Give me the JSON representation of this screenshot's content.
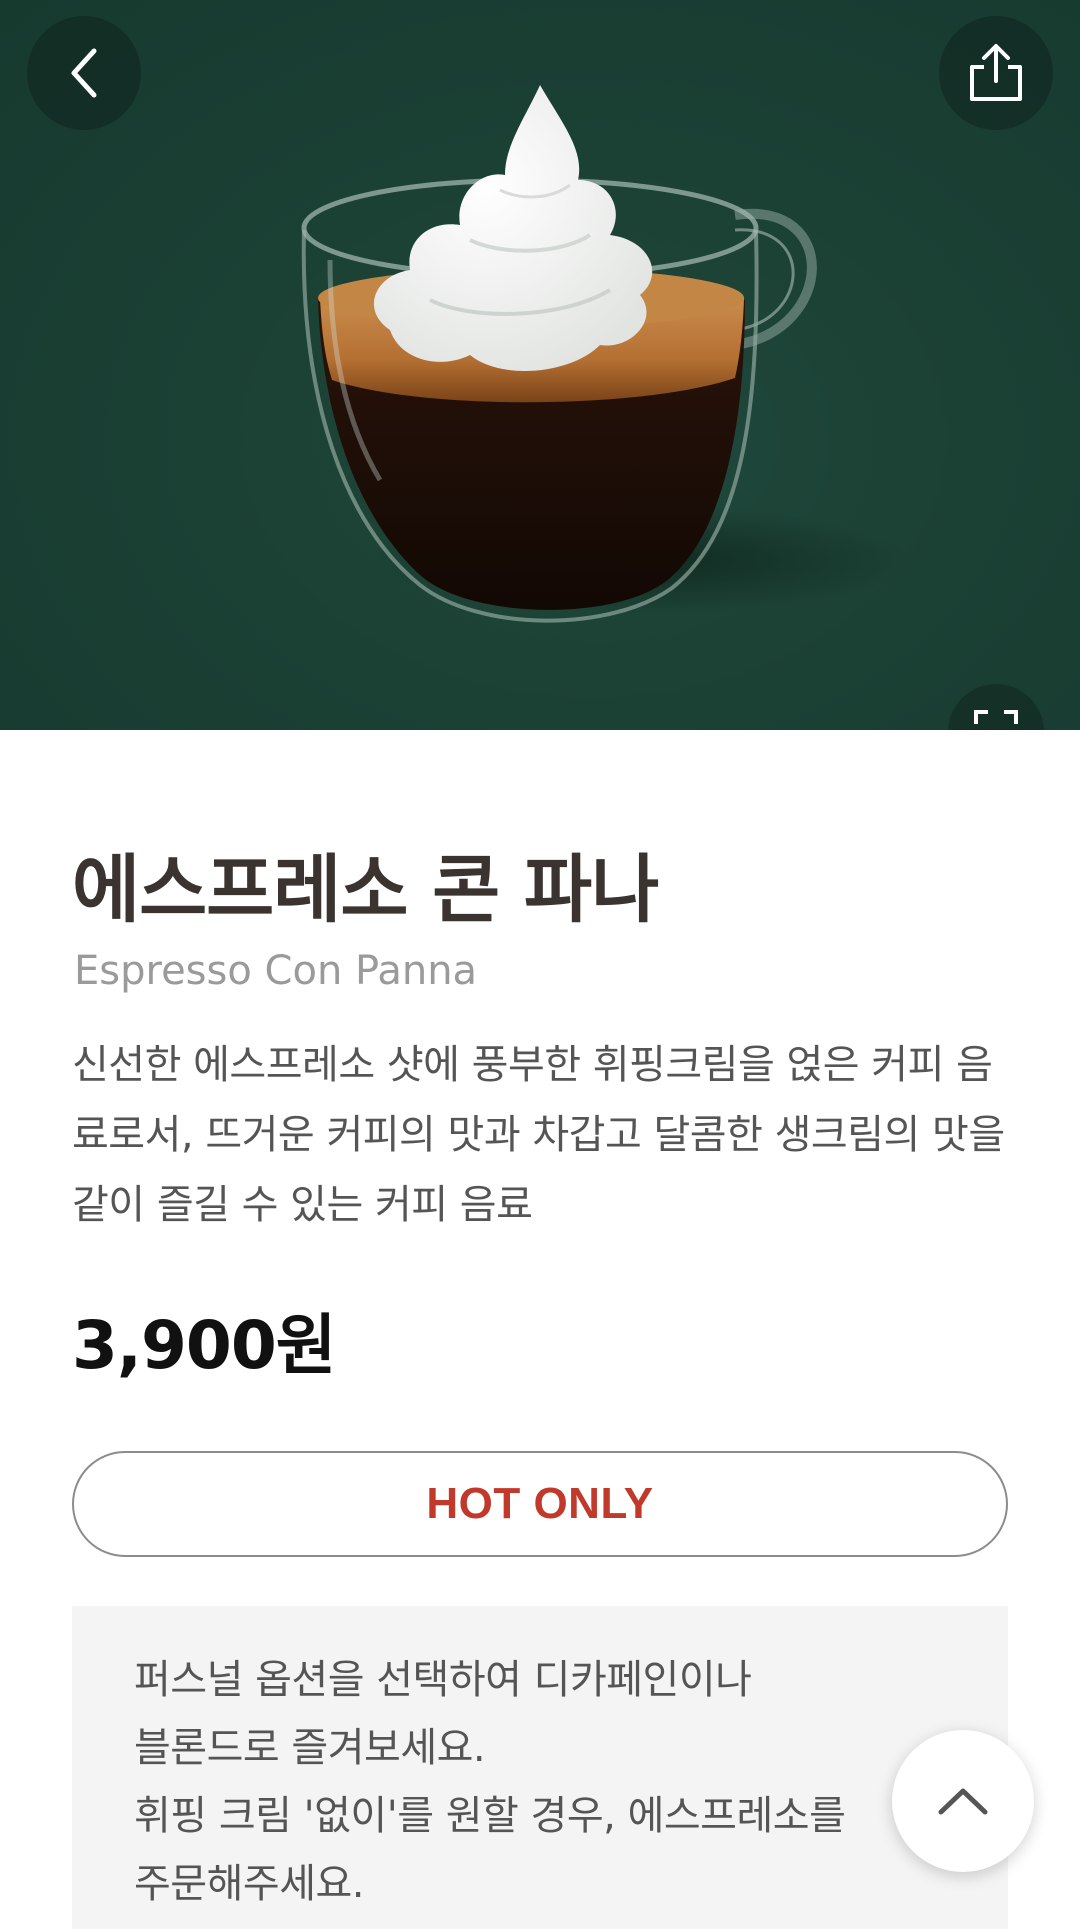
{
  "product": {
    "name_ko": "에스프레소 콘 파나",
    "name_en": "Espresso Con Panna",
    "description": "신선한 에스프레소 샷에 풍부한 휘핑크림을 얹은 커피 음료로서, 뜨거운 커피의 맛과 차갑고 달콤한 생크림의 맛을 같이 즐길 수 있는 커피 음료",
    "price": "3,900원",
    "temperature": "HOT ONLY",
    "notes": [
      "퍼스널 옵션을 선택하여 디카페인이나",
      "블론드로 즐겨보세요.",
      "휘핑 크림 '없이'를 원할 경우, 에스프레소를",
      "주문해주세요."
    ]
  },
  "icons": {
    "back": "chevron-left-icon",
    "share": "share-icon",
    "zoom": "expand-icon",
    "scroll_top": "chevron-up-icon"
  },
  "colors": {
    "hero_background": "#1b4034",
    "temperature_text": "#c0392b",
    "title": "#3a3330",
    "subtitle": "#9a9a9a",
    "body_text": "#555555",
    "price": "#111111",
    "info_box": "#f4f4f4"
  }
}
